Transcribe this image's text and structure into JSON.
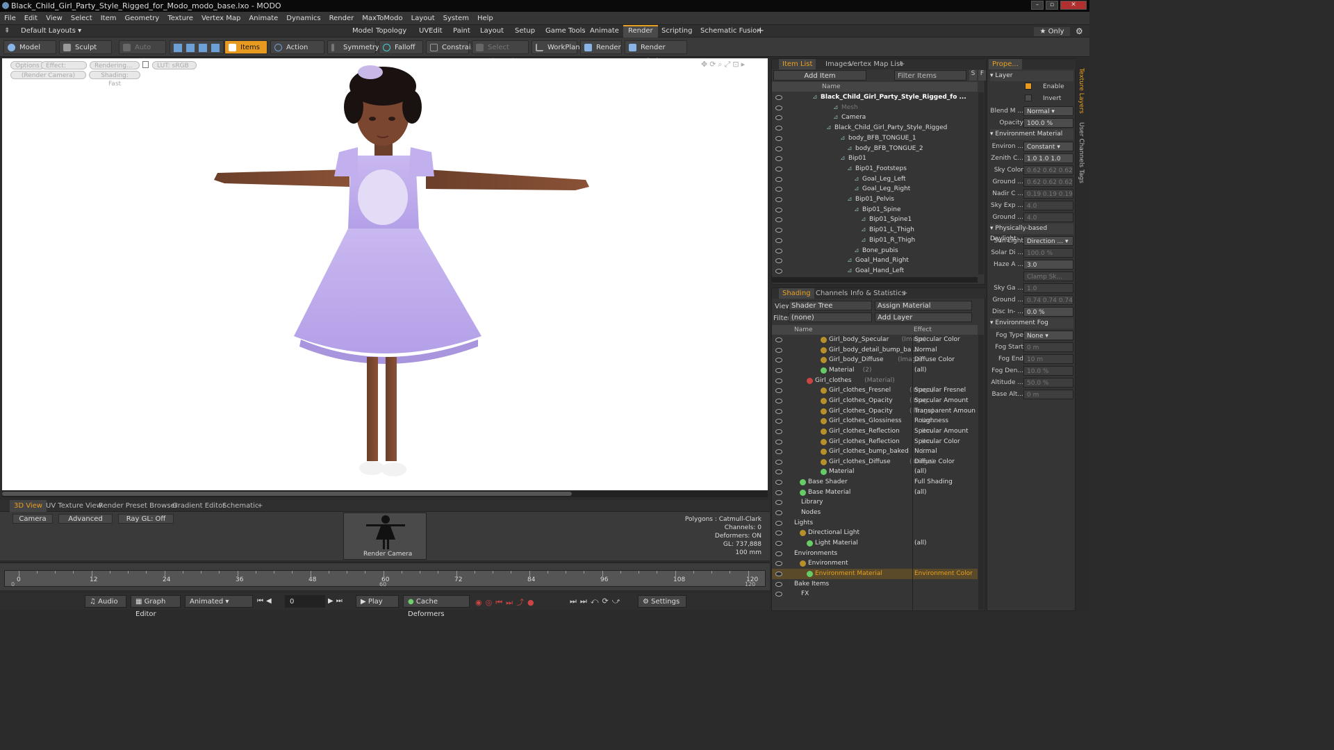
{
  "window": {
    "title": "Black_Child_Girl_Party_Style_Rigged_for_Modo_modo_base.lxo - MODO"
  },
  "menu": [
    "File",
    "Edit",
    "View",
    "Select",
    "Item",
    "Geometry",
    "Texture",
    "Vertex Map",
    "Animate",
    "Dynamics",
    "Render",
    "MaxToModo",
    "Layout",
    "System",
    "Help"
  ],
  "layoutbar": {
    "default_layouts": "Default Layouts ▾",
    "tabs": [
      "Model",
      "Topology",
      "UVEdit",
      "Paint",
      "Layout",
      "Setup",
      "Game Tools",
      "Animate",
      "Render",
      "Scripting",
      "Schematic Fusion"
    ],
    "active": "Render",
    "plus": "+",
    "only": "★ Only"
  },
  "toolbar": {
    "model": "Model",
    "sculpt": "Sculpt",
    "auto_select": "Auto Select",
    "items": "Items",
    "action_center": "Action Center",
    "symmetry": "Symmetry",
    "falloff": "Falloff",
    "constraints": "Constrai...",
    "select_through": "Select Through",
    "workplane": "WorkPlane",
    "render": "Render",
    "render_window": "Render Window"
  },
  "viewport": {
    "pills": [
      "Options",
      "Effect: (Shadi...",
      "Rendering...",
      "LUT: sRGB",
      "(Render Camera)",
      "Shading: Fast"
    ]
  },
  "bottom_tabs": [
    "3D View",
    "UV Texture View",
    "Render Preset Browser",
    "Gradient Editor",
    "Schematic",
    "+"
  ],
  "bpanel": {
    "camera": "Camera",
    "advanced": "Advanced",
    "raygl": "Ray GL: Off",
    "thumb_label": "Render Camera",
    "stats": [
      "Polygons : Catmull-Clark",
      "Channels: 0",
      "Deformers: ON",
      "GL: 737,888",
      "100 mm"
    ]
  },
  "timeline": {
    "marks": [
      "0",
      "12",
      "24",
      "36",
      "48",
      "60",
      "72",
      "84",
      "96",
      "108",
      "120"
    ],
    "sub": [
      "0",
      "60",
      "120"
    ]
  },
  "playbar": {
    "audio": "Audio",
    "graph_editor": "Graph Editor",
    "animated": "Animated",
    "frame": "0",
    "play": "Play",
    "cache": "Cache Deformers",
    "settings": "Settings"
  },
  "itemlist": {
    "tabs": [
      "Item List",
      "Images",
      "Vertex Map List",
      "+"
    ],
    "add_item": "Add Item",
    "filter": "Filter Items",
    "col_name": "Name",
    "rows": [
      {
        "label": "Black_Child_Girl_Party_Style_Rigged_fo ...",
        "indent": 6,
        "bold": true
      },
      {
        "label": "Mesh",
        "indent": 9,
        "dim": true
      },
      {
        "label": "Camera",
        "indent": 9
      },
      {
        "label": "Black_Child_Girl_Party_Style_Rigged",
        "indent": 8
      },
      {
        "label": "body_BFB_TONGUE_1",
        "indent": 10
      },
      {
        "label": "body_BFB_TONGUE_2",
        "indent": 11
      },
      {
        "label": "Bip01",
        "indent": 10
      },
      {
        "label": "Bip01_Footsteps",
        "indent": 11
      },
      {
        "label": "Goal_Leg_Left",
        "indent": 12
      },
      {
        "label": "Goal_Leg_Right",
        "indent": 12
      },
      {
        "label": "Bip01_Pelvis",
        "indent": 11
      },
      {
        "label": "Bip01_Spine",
        "indent": 12
      },
      {
        "label": "Bip01_Spine1",
        "indent": 13
      },
      {
        "label": "Bip01_L_Thigh",
        "indent": 13
      },
      {
        "label": "Bip01_R_Thigh",
        "indent": 13
      },
      {
        "label": "Bone_pubis",
        "indent": 12
      },
      {
        "label": "Goal_Hand_Right",
        "indent": 11
      },
      {
        "label": "Goal_Hand_Left",
        "indent": 11
      }
    ]
  },
  "shading": {
    "tabs": [
      "Shading",
      "Channels",
      "Info & Statistics",
      "+"
    ],
    "view_label": "View",
    "view_value": "Shader Tree",
    "assign": "Assign Material",
    "filter_label": "Filter",
    "filter_value": "(none)",
    "add_layer": "Add Layer",
    "col_name": "Name",
    "col_effect": "Effect",
    "rows": [
      {
        "label": "Girl_body_Specular",
        "tag": "(Image)",
        "effect": "Specular Color",
        "indent": 8
      },
      {
        "label": "Girl_body_detail_bump_ba ...",
        "tag": "",
        "effect": "Normal",
        "indent": 8
      },
      {
        "label": "Girl_body_Diffuse",
        "tag": "(Image)",
        "effect": "Diffuse Color",
        "indent": 8
      },
      {
        "label": "Material",
        "tag": "(2)",
        "effect": "(all)",
        "indent": 8
      },
      {
        "label": "Girl_clothes",
        "tag": "(Material)",
        "effect": "",
        "indent": 6
      },
      {
        "label": "Girl_clothes_Fresnel",
        "tag": "(Image)",
        "effect": "Specular Fresnel",
        "indent": 8
      },
      {
        "label": "Girl_clothes_Opacity",
        "tag": "(Imag...",
        "effect": "Specular Amount",
        "indent": 8
      },
      {
        "label": "Girl_clothes_Opacity",
        "tag": "(Image)",
        "effect": "Transparent Amount",
        "indent": 8
      },
      {
        "label": "Girl_clothes_Glossiness",
        "tag": "(Im...",
        "effect": "Roughness",
        "indent": 8
      },
      {
        "label": "Girl_clothes_Reflection",
        "tag": "(Im...",
        "effect": "Specular Amount",
        "indent": 8
      },
      {
        "label": "Girl_clothes_Reflection",
        "tag": "(Im...",
        "effect": "Specular Color",
        "indent": 8
      },
      {
        "label": "Girl_clothes_bump_baked",
        "tag": "(...",
        "effect": "Normal",
        "indent": 8
      },
      {
        "label": "Girl_clothes_Diffuse",
        "tag": "(Image)",
        "effect": "Diffuse Color",
        "indent": 8
      },
      {
        "label": "Material",
        "tag": "",
        "effect": "(all)",
        "indent": 8
      },
      {
        "label": "Base Shader",
        "tag": "",
        "effect": "Full Shading",
        "indent": 5
      },
      {
        "label": "Base Material",
        "tag": "",
        "effect": "(all)",
        "indent": 5
      },
      {
        "label": "Library",
        "tag": "",
        "effect": "",
        "indent": 4
      },
      {
        "label": "Nodes",
        "tag": "",
        "effect": "",
        "indent": 4
      },
      {
        "label": "Lights",
        "tag": "",
        "effect": "",
        "indent": 3
      },
      {
        "label": "Directional Light",
        "tag": "",
        "effect": "",
        "indent": 5
      },
      {
        "label": "Light Material",
        "tag": "",
        "effect": "(all)",
        "indent": 6
      },
      {
        "label": "Environments",
        "tag": "",
        "effect": "",
        "indent": 3
      },
      {
        "label": "Environment",
        "tag": "",
        "effect": "",
        "indent": 5
      },
      {
        "label": "Environment Material",
        "tag": "",
        "effect": "Environment Color",
        "indent": 6,
        "selected": true
      },
      {
        "label": "Bake Items",
        "tag": "",
        "effect": "",
        "indent": 3
      },
      {
        "label": "FX",
        "tag": "",
        "effect": "",
        "indent": 4
      }
    ]
  },
  "props": {
    "tab": "Prope...",
    "section_layer": "Layer",
    "enable": "Enable",
    "invert": "Invert",
    "rows": [
      {
        "label": "Blend M ...",
        "value": "Normal ▾",
        "dim": false
      },
      {
        "label": "Opacity",
        "value": "100.0 %",
        "dim": false
      },
      {
        "section": "Environment Material"
      },
      {
        "label": "Environ ...",
        "value": "Constant ▾",
        "dim": false
      },
      {
        "label": "Zenith C...",
        "value": "1.0 1.0 1.0",
        "dim": false
      },
      {
        "label": "Sky Color",
        "value": "0.62 0.62 0.62",
        "dim": true
      },
      {
        "label": "Ground ...",
        "value": "0.62 0.62 0.62",
        "dim": true
      },
      {
        "label": "Nadir C ...",
        "value": "0.19 0.19 0.19",
        "dim": true
      },
      {
        "label": "Sky Exp ...",
        "value": "4.0",
        "dim": true
      },
      {
        "label": "Ground ...",
        "value": "4.0",
        "dim": true
      },
      {
        "section": "Physically-based Daylight"
      },
      {
        "label": "Sun Light",
        "value": "Direction ... ▾",
        "dim": false
      },
      {
        "label": "Solar Di ...",
        "value": "100.0 %",
        "dim": true
      },
      {
        "label": "Haze A ...",
        "value": "3.0",
        "dim": false
      },
      {
        "label": "",
        "value": "Clamp Sk...",
        "dim": true
      },
      {
        "label": "Sky Ga ...",
        "value": "1.0",
        "dim": true
      },
      {
        "label": "Ground ...",
        "value": "0.74 0.74 0.74",
        "dim": true
      },
      {
        "label": "Disc In- ...",
        "value": "0.0 %",
        "dim": false
      },
      {
        "section": "Environment Fog"
      },
      {
        "label": "Fog Type",
        "value": "None ▾",
        "dim": false
      },
      {
        "label": "Fog Start",
        "value": "0 m",
        "dim": true
      },
      {
        "label": "Fog End",
        "value": "10 m",
        "dim": true
      },
      {
        "label": "Fog Den...",
        "value": "10.0 %",
        "dim": true
      },
      {
        "label": "Altitude ...",
        "value": "50.0 %",
        "dim": true
      },
      {
        "label": "Base Alt...",
        "value": "0 m",
        "dim": true
      }
    ]
  },
  "sidetabs": [
    "Texture Layers",
    "User Channels",
    "Tags"
  ]
}
